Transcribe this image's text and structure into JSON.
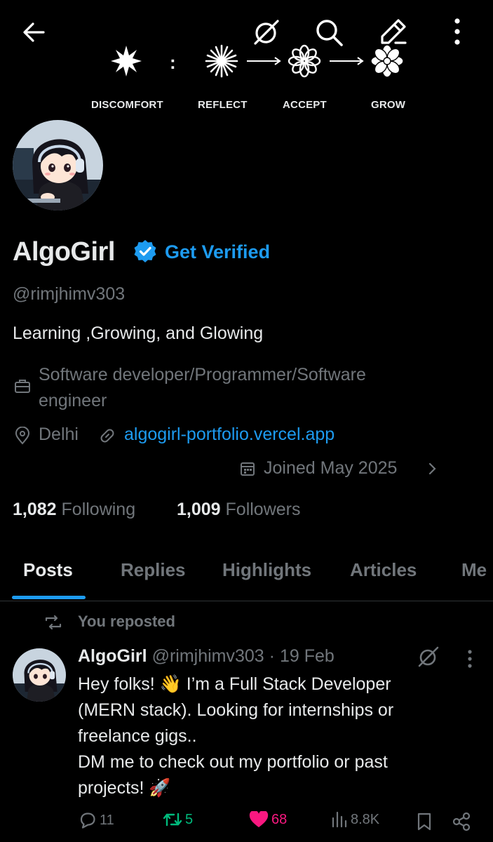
{
  "header": {
    "back_icon": "arrow-left-icon",
    "grok_icon": "grok-icon",
    "search_icon": "search-icon",
    "edit_icon": "pen-icon",
    "more_icon": "vertical-dots-icon"
  },
  "banner": {
    "separator": ":",
    "steps": [
      {
        "label": "DISCOMFORT"
      },
      {
        "label": "REFLECT"
      },
      {
        "label": "ACCEPT"
      },
      {
        "label": "GROW"
      }
    ]
  },
  "profile": {
    "name": "AlgoGirl",
    "get_verified": "Get Verified",
    "handle": "@rimjhimv303",
    "bio": "Learning ,Growing, and Glowing",
    "profession_line1": "Software developer/Programmer/Software",
    "profession_line2": "engineer",
    "location": "Delhi",
    "website": "algogirl-portfolio.vercel.app",
    "joined": "Joined May 2025",
    "following_count": "1,082",
    "following_label": "Following",
    "followers_count": "1,009",
    "followers_label": "Followers",
    "accent_color": "#1d9bf0"
  },
  "tabs": [
    {
      "label": "Posts",
      "active": true
    },
    {
      "label": "Replies"
    },
    {
      "label": "Highlights"
    },
    {
      "label": "Articles"
    },
    {
      "label": "Me"
    }
  ],
  "post": {
    "repost_label": "You reposted",
    "author_name": "AlgoGirl",
    "author_handle": "@rimjhimv303",
    "dot": "·",
    "date": "19 Feb",
    "line1": "Hey folks! 👋 I’m a Full Stack Developer",
    "line2": "(MERN stack). Looking for internships or",
    "line3": "freelance gigs..",
    "line4": "DM me to check out my portfolio or past",
    "line5": "projects! 🚀",
    "replies": "11",
    "reposts": "5",
    "likes": "68",
    "views": "8.8K",
    "like_color": "#f91880",
    "repost_color": "#00ba7c"
  }
}
